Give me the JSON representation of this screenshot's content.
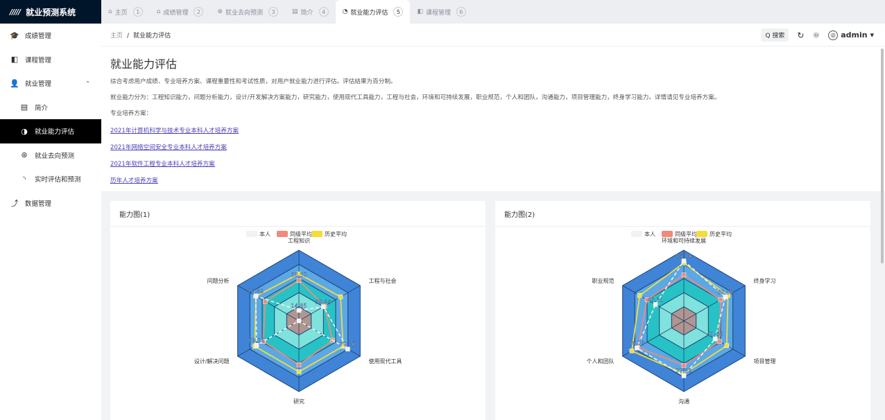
{
  "app": {
    "title": "就业预测系统"
  },
  "tabs": [
    {
      "label": "主页",
      "num": "1",
      "icon": "home-icon",
      "glyph": "⌂"
    },
    {
      "label": "成绩管理",
      "num": "2",
      "icon": "grad-icon",
      "glyph": "⌂"
    },
    {
      "label": "就业去向预测",
      "num": "3",
      "icon": "forecast-icon",
      "glyph": "⊕"
    },
    {
      "label": "简介",
      "num": "4",
      "icon": "doc-icon",
      "glyph": "▤"
    },
    {
      "label": "就业能力评估",
      "num": "5",
      "icon": "gauge-icon",
      "glyph": "◔",
      "active": true
    },
    {
      "label": "课程管理",
      "num": "6",
      "icon": "book-icon",
      "glyph": "◧"
    }
  ],
  "sidebar": {
    "items": [
      {
        "label": "成绩管理",
        "icon": "graduation-cap-icon",
        "glyph": "🎓"
      },
      {
        "label": "课程管理",
        "icon": "book-icon",
        "glyph": "◧"
      },
      {
        "label": "就业管理",
        "icon": "user-icon",
        "glyph": "👤"
      },
      {
        "label": "简介",
        "icon": "doc-icon",
        "glyph": "▤"
      },
      {
        "label": "就业能力评估",
        "icon": "gauge-icon",
        "glyph": "◑"
      },
      {
        "label": "就业去向预测",
        "icon": "forecast-icon",
        "glyph": "⊛"
      },
      {
        "label": "实时评估和预测",
        "icon": "spinner-icon",
        "glyph": "◝"
      },
      {
        "label": "数据管理",
        "icon": "upload-icon",
        "glyph": "⤴"
      }
    ]
  },
  "breadcrumb": {
    "home": "主页",
    "sep": "/",
    "current": "就业能力评估"
  },
  "topbar": {
    "search": "搜索",
    "search_glyph": "Q",
    "refresh_glyph": "↻",
    "theme_glyph": "☼",
    "avatar_glyph": "◎",
    "user": "admin",
    "caret": "▾"
  },
  "intro": {
    "title": "就业能力评估",
    "p1": "综合考虑用户成绩、专业培养方案、课程重要性和考试性质，对用户就业能力进行评估。评估结果为百分制。",
    "p2": "就业能力分为：工程知识能力，问题分析能力，设计/开发解决方案能力，研究能力，使用现代工具能力，工程与社会，环境和可持续发展，职业规范，个人和团队，沟通能力，项目管理能力，终身学习能力。详情请见专业培养方案。",
    "p3": "专业培养方案：",
    "links": [
      "2021年计算机科学与技术专业本科人才培养方案",
      "2021年网络空间安全专业本科人才培养方案",
      "2021年软件工程专业本科人才培养方案",
      "历年人才培养方案"
    ]
  },
  "colors": {
    "self": "#f2f2f2",
    "peer": "#f08a7a",
    "history": "#f4dc3a"
  },
  "chart_data": [
    {
      "type": "radar",
      "title": "能力图(1)",
      "legend": [
        "本人",
        "同级平均",
        "历史平均"
      ],
      "indicators": [
        "工程知识",
        "工程与社会",
        "使用现代工具",
        "研究",
        "设计/解决问题",
        "问题分析"
      ],
      "max": 100,
      "series": [
        {
          "name": "本人",
          "values": [
            14.85,
            39.94,
            79.7,
            0,
            69.06,
            70.49
          ],
          "labels": [
            "14.85",
            "39.94",
            "79.70",
            "",
            "69.06",
            "70.49"
          ]
        },
        {
          "name": "同级平均",
          "values": [
            57,
            42,
            55,
            62,
            58,
            55
          ]
        },
        {
          "name": "历史平均",
          "values": [
            66.5,
            68,
            72,
            72,
            72,
            70
          ]
        }
      ],
      "extra_labels": [
        {
          "axis": 0,
          "text": "66.50"
        }
      ]
    },
    {
      "type": "radar",
      "title": "能力图(2)",
      "legend": [
        "本人",
        "同级平均",
        "历史平均"
      ],
      "indicators": [
        "环境和可持续发展",
        "终身学习",
        "项目管理",
        "沟通",
        "个人和团队",
        "职业规范"
      ],
      "max": 100,
      "series": [
        {
          "name": "本人",
          "values": [
            84.84,
            67.58,
            51.0,
            77.58,
            76.78,
            46.31
          ],
          "labels": [
            "84.84",
            "67.58",
            "51.00",
            "77.58",
            "76.78",
            "46.31"
          ]
        },
        {
          "name": "同级平均",
          "values": [
            65,
            60,
            58,
            63,
            75,
            60
          ]
        },
        {
          "name": "历史平均",
          "values": [
            82,
            72,
            70,
            75,
            85,
            72
          ]
        }
      ]
    }
  ]
}
